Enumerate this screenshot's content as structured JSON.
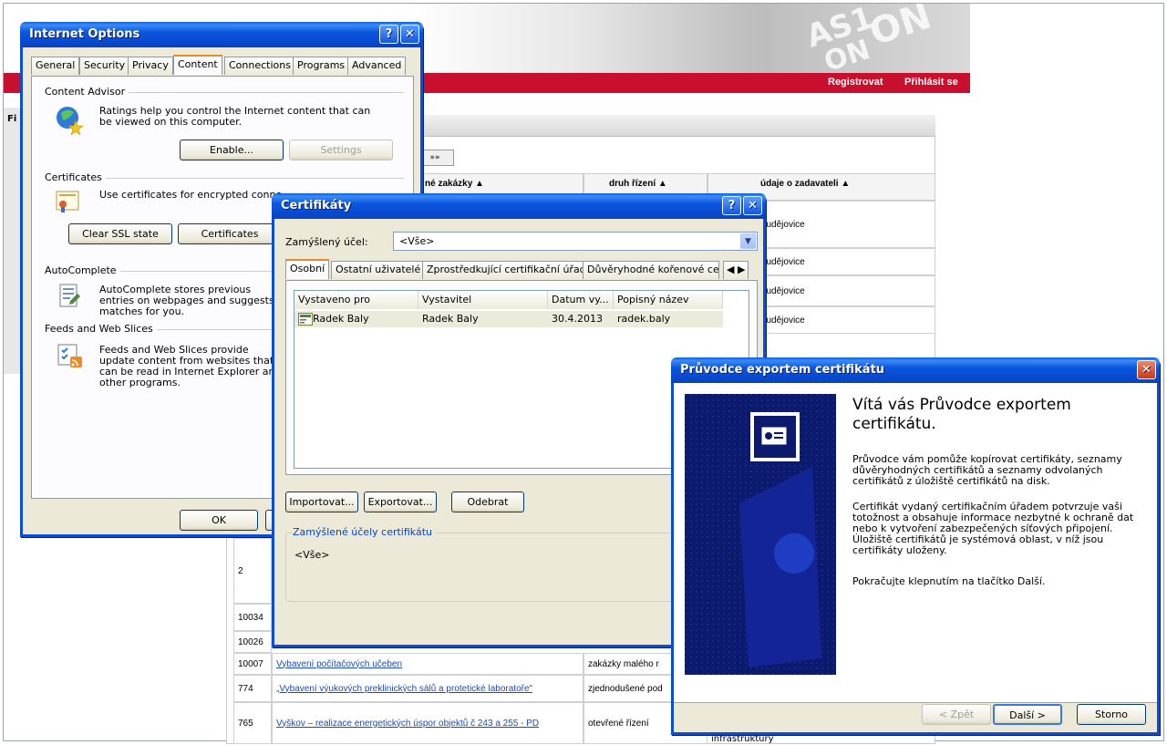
{
  "background_page": {
    "nav_links": [
      "Registrovat",
      "Přihlásit se"
    ],
    "left_label": "Fi",
    "pager_label": "»»",
    "headers": [
      "né zakázky ▲",
      "druh řízení ▲",
      "údaje o zadavateli ▲"
    ],
    "zadavatel_rows": [
      "ěsto České Budějovice",
      "ěsto České Budějovice",
      "ěsto České Budějovice",
      "ěsto České Budějovice"
    ],
    "rows": [
      {
        "id": "2",
        "name": "",
        "druh": ""
      },
      {
        "id": "10034",
        "name": "",
        "druh": ""
      },
      {
        "id": "10026",
        "name": "",
        "druh": ""
      },
      {
        "id": "10007",
        "name": "Vybavení počítačových učeben",
        "druh": "zakázky malého r"
      },
      {
        "id": "774",
        "name": "„Vybavení výukových preklinických sálů a protetické laboratoře\"",
        "druh": "zjednodušené pod"
      },
      {
        "id": "765",
        "name": "Vyškov – realizace energetických úspor objektů č 243 a 255 - PD",
        "druh": "otevřené řízení"
      }
    ],
    "bottom_right_text": "infrastruktury"
  },
  "internet_options": {
    "title": "Internet Options",
    "tabs": [
      "General",
      "Security",
      "Privacy",
      "Content",
      "Connections",
      "Programs",
      "Advanced"
    ],
    "active_tab": "Content",
    "content_advisor": {
      "label": "Content Advisor",
      "text": "Ratings help you control the Internet content that can be viewed on this computer.",
      "enable_button": "Enable...",
      "settings_button": "Settings"
    },
    "certificates": {
      "label": "Certificates",
      "text": "Use certificates for encrypted conne",
      "clear_ssl_button": "Clear SSL state",
      "certificates_button": "Certificates"
    },
    "autocomplete": {
      "label": "AutoComplete",
      "text": "AutoComplete stores previous entries on webpages and suggests matches for you."
    },
    "feeds": {
      "label": "Feeds and Web Slices",
      "text": "Feeds and Web Slices provide update content from websites that can be read in Internet Explorer and other programs."
    },
    "ok_button": "OK"
  },
  "certifikaty": {
    "title": "Certifikáty",
    "purpose_label": "Zamýšlený účel:",
    "purpose_value": "<Vše>",
    "tabs": [
      "Osobní",
      "Ostatní uživatelé",
      "Zprostředkující certifikační úřady",
      "Důvěryhodné kořenové cert"
    ],
    "active_tab": "Osobní",
    "columns": [
      "Vystaveno pro",
      "Vystavitel",
      "Datum vy...",
      "Popisný název"
    ],
    "rows": [
      {
        "issued_to": "Radek Baly",
        "issuer": "Radek Baly",
        "date": "30.4.2013",
        "friendly": "radek.baly"
      }
    ],
    "import_button": "Importovat...",
    "export_button": "Exportovat...",
    "remove_button": "Odebrat",
    "purposes_group_label": "Zamýšlené účely certifikátu",
    "purposes_value": "<Vše>"
  },
  "wizard": {
    "title": "Průvodce exportem certifikátu",
    "heading": "Vítá vás Průvodce exportem certifikátu.",
    "paragraphs": [
      "Průvodce vám pomůže kopírovat certifikáty, seznamy důvěryhodných certifikátů a seznamy odvolaných certifikátů z úložiště certifikátů na disk.",
      "Certifikát vydaný certifikačním úřadem potvrzuje vaši totožnost a obsahuje informace nezbytné k ochraně dat nebo k vytvoření zabezpečených síťových připojení. Úložiště certifikátů je systémová oblast, v níž jsou certifikáty uloženy.",
      "Pokračujte klepnutím na tlačítko Další."
    ],
    "back_button": "< Zpět",
    "next_button": "Další >",
    "cancel_button": "Storno"
  }
}
